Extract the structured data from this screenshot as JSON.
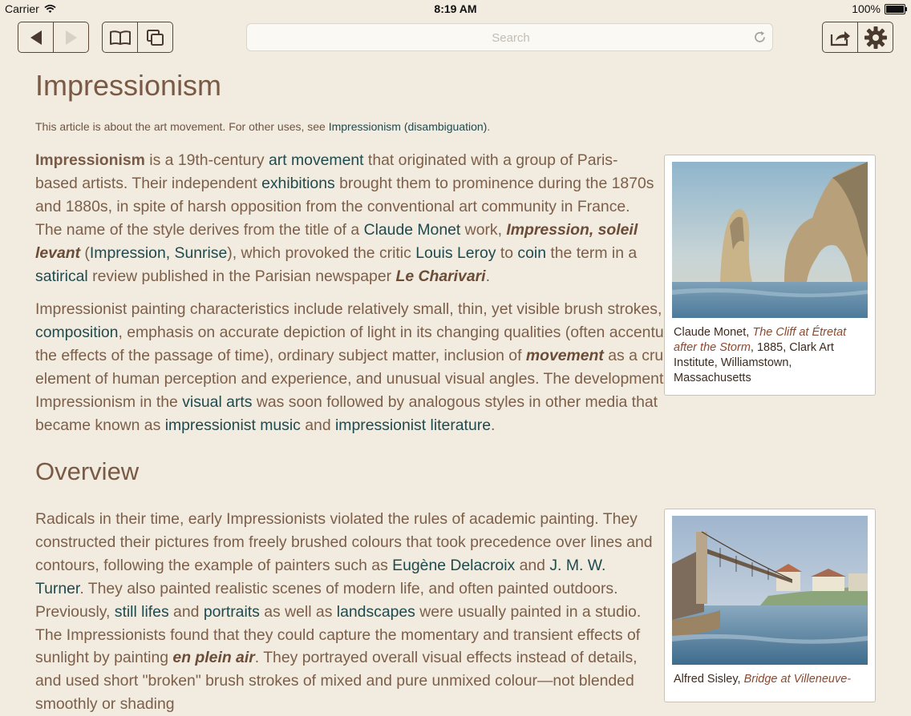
{
  "status_bar": {
    "carrier": "Carrier",
    "time": "8:19 AM",
    "battery": "100%"
  },
  "toolbar": {
    "back_icon": "back-arrow-icon",
    "forward_icon": "forward-arrow-icon",
    "bookmarks_icon": "open-book-icon",
    "tabs_icon": "pages-icon",
    "share_icon": "share-icon",
    "settings_icon": "gear-icon",
    "search_placeholder": "Search",
    "search_value": ""
  },
  "article": {
    "title": "Impressionism",
    "hatnote": {
      "text": "This article is about the art movement. For other uses, see ",
      "link": "Impressionism (disambiguation)",
      "end": "."
    },
    "paragraphs": [
      [
        {
          "t": "Impressionism",
          "k": "b"
        },
        {
          "t": " is a 19th-century ",
          "k": "t"
        },
        {
          "t": "art movement",
          "k": "l"
        },
        {
          "t": " that originated with a group of Paris-based artists. Their independent ",
          "k": "t"
        },
        {
          "t": "exhibitions",
          "k": "l"
        },
        {
          "t": " brought them to prominence during the 1870s and 1880s, in spite of harsh opposition from the conventional art community in France. The name of the style derives from the title of a ",
          "k": "t"
        },
        {
          "t": "Claude Monet",
          "k": "l"
        },
        {
          "t": " work, ",
          "k": "t"
        },
        {
          "t": "Impression, soleil levant",
          "k": "i"
        },
        {
          "t": " (",
          "k": "t"
        },
        {
          "t": "Impression, Sunrise",
          "k": "l"
        },
        {
          "t": "), which provoked the critic ",
          "k": "t"
        },
        {
          "t": "Louis Leroy",
          "k": "l"
        },
        {
          "t": " to ",
          "k": "t"
        },
        {
          "t": "coin",
          "k": "l"
        },
        {
          "t": " the term in a ",
          "k": "t"
        },
        {
          "t": "satirical",
          "k": "l"
        },
        {
          "t": " review published in the Parisian newspaper ",
          "k": "t"
        },
        {
          "t": "Le Charivari",
          "k": "i"
        },
        {
          "t": ".",
          "k": "t"
        }
      ],
      [
        {
          "t": "Impressionist painting characteristics include relatively small, thin, yet visible brush strokes, open ",
          "k": "t"
        },
        {
          "t": "composition",
          "k": "l"
        },
        {
          "t": ", emphasis on accurate depiction of light in its changing qualities (often accentuating the effects of the passage of time), ordinary subject matter, inclusion of ",
          "k": "t"
        },
        {
          "t": "movement",
          "k": "i"
        },
        {
          "t": " as a crucial element of human perception and experience, and unusual visual angles. The development of Impressionism in the ",
          "k": "t"
        },
        {
          "t": "visual arts",
          "k": "l"
        },
        {
          "t": " was soon followed by analo­gous styles in other media that became known as ",
          "k": "t"
        },
        {
          "t": "impressionist music",
          "k": "l"
        },
        {
          "t": " and ",
          "k": "t"
        },
        {
          "t": "impressionist literature",
          "k": "l"
        },
        {
          "t": ".",
          "k": "t"
        }
      ],
      [
        {
          "t": "Radicals in their time, early Impressionists violated the rules of academic painting. They constructed their pictures from freely brushed colours that took precedence over lines and contours, following the example of painters such as ",
          "k": "t"
        },
        {
          "t": "Eugène Delacroix",
          "k": "l"
        },
        {
          "t": " and ",
          "k": "t"
        },
        {
          "t": "J. M. W. Turner",
          "k": "l"
        },
        {
          "t": ". They also painted realistic scenes of modern life, and often painted outdoors. Previously, ",
          "k": "t"
        },
        {
          "t": "still lifes",
          "k": "l"
        },
        {
          "t": " and ",
          "k": "t"
        },
        {
          "t": "portraits",
          "k": "l"
        },
        {
          "t": " as well as ",
          "k": "t"
        },
        {
          "t": "landscapes",
          "k": "l"
        },
        {
          "t": " were usually painted in a studio. The Impres­sionists found that they could capture the momentary and transient effects of sunlight by painting ",
          "k": "t"
        },
        {
          "t": "en plein air",
          "k": "i"
        },
        {
          "t": ". They portrayed overall visual effects instead of details, and used short \"broken\" brush strokes of mixed and pure unmixed colour—not blended smoothly or shad­ing",
          "k": "t"
        }
      ]
    ],
    "section_heading": "Overview",
    "figures": [
      {
        "image": "painting-cliff-etretat-image",
        "caption": [
          {
            "t": "Claude Monet, ",
            "k": "t"
          },
          {
            "t": "The Cliff at Étretat after the Storm",
            "k": "i"
          },
          {
            "t": ", 1885, Clark Art Institute, Williamstown, Massachusetts",
            "k": "t"
          }
        ]
      },
      {
        "image": "painting-bridge-villeneuve-image",
        "caption": [
          {
            "t": "Alfred Sisley, ",
            "k": "t"
          },
          {
            "t": "Bridge at Villeneuve-",
            "k": "i"
          }
        ]
      }
    ]
  }
}
